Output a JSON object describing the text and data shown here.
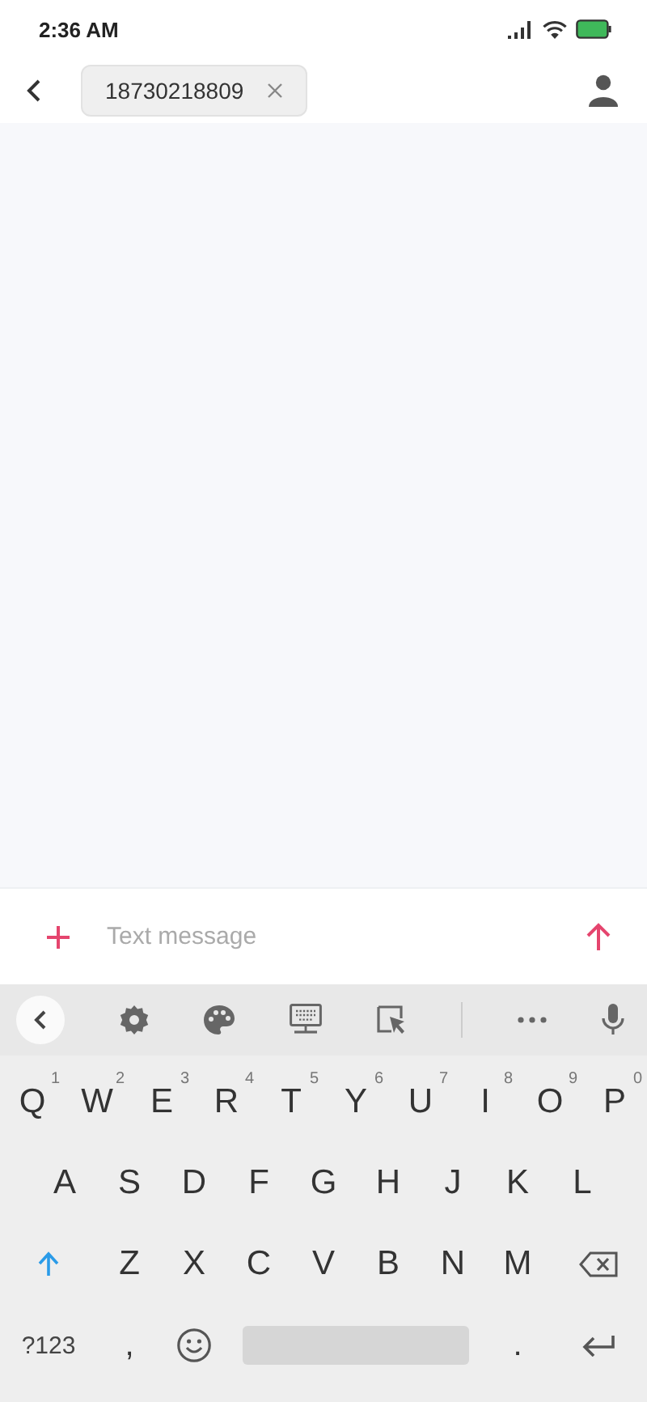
{
  "status_bar": {
    "time": "2:36 AM"
  },
  "header": {
    "recipient": "18730218809"
  },
  "compose": {
    "placeholder": "Text message"
  },
  "keyboard": {
    "rows": [
      {
        "keys": [
          {
            "kind": "letter",
            "label": "Q",
            "hint": "1"
          },
          {
            "kind": "letter",
            "label": "W",
            "hint": "2"
          },
          {
            "kind": "letter",
            "label": "E",
            "hint": "3"
          },
          {
            "kind": "letter",
            "label": "R",
            "hint": "4"
          },
          {
            "kind": "letter",
            "label": "T",
            "hint": "5"
          },
          {
            "kind": "letter",
            "label": "Y",
            "hint": "6"
          },
          {
            "kind": "letter",
            "label": "U",
            "hint": "7"
          },
          {
            "kind": "letter",
            "label": "I",
            "hint": "8"
          },
          {
            "kind": "letter",
            "label": "O",
            "hint": "9"
          },
          {
            "kind": "letter",
            "label": "P",
            "hint": "0"
          }
        ]
      },
      {
        "keys": [
          {
            "kind": "letter",
            "label": "A"
          },
          {
            "kind": "letter",
            "label": "S"
          },
          {
            "kind": "letter",
            "label": "D"
          },
          {
            "kind": "letter",
            "label": "F"
          },
          {
            "kind": "letter",
            "label": "G"
          },
          {
            "kind": "letter",
            "label": "H"
          },
          {
            "kind": "letter",
            "label": "J"
          },
          {
            "kind": "letter",
            "label": "K"
          },
          {
            "kind": "letter",
            "label": "L"
          }
        ]
      },
      {
        "keys": [
          {
            "kind": "shift",
            "on": true
          },
          {
            "kind": "letter",
            "label": "Z"
          },
          {
            "kind": "letter",
            "label": "X"
          },
          {
            "kind": "letter",
            "label": "C"
          },
          {
            "kind": "letter",
            "label": "V"
          },
          {
            "kind": "letter",
            "label": "B"
          },
          {
            "kind": "letter",
            "label": "N"
          },
          {
            "kind": "letter",
            "label": "M"
          },
          {
            "kind": "backspace"
          }
        ]
      },
      {
        "keys": [
          {
            "kind": "symbols",
            "label": "?123"
          },
          {
            "kind": "punct",
            "label": ","
          },
          {
            "kind": "emoji"
          },
          {
            "kind": "space"
          },
          {
            "kind": "punct",
            "label": "."
          },
          {
            "kind": "enter"
          }
        ]
      }
    ]
  }
}
